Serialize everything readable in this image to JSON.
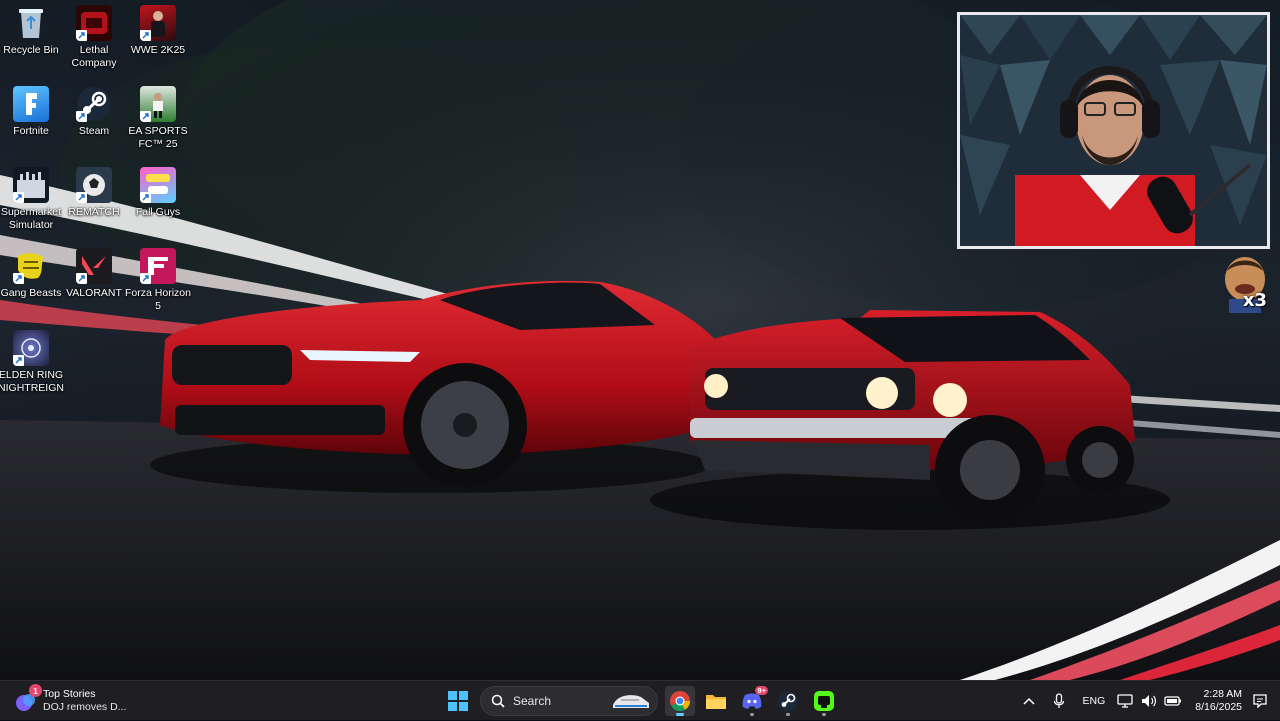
{
  "desktop": {
    "icons": [
      {
        "label": "Recycle Bin",
        "icon": "recycle-bin-icon"
      },
      {
        "label": "Lethal Company",
        "icon": "lethal-company-icon"
      },
      {
        "label": "WWE 2K25",
        "icon": "wwe-2k25-icon"
      },
      {
        "label": "Fortnite",
        "icon": "fortnite-icon"
      },
      {
        "label": "Steam",
        "icon": "steam-icon"
      },
      {
        "label": "EA SPORTS FC™ 25",
        "icon": "ea-sports-fc-icon"
      },
      {
        "label": "Supermarket Simulator",
        "icon": "supermarket-simulator-icon"
      },
      {
        "label": "REMATCH",
        "icon": "rematch-icon"
      },
      {
        "label": "Fall Guys",
        "icon": "fall-guys-icon"
      },
      {
        "label": "Gang Beasts",
        "icon": "gang-beasts-icon"
      },
      {
        "label": "VALORANT",
        "icon": "valorant-icon"
      },
      {
        "label": "Forza Horizon 5",
        "icon": "forza-horizon-icon"
      },
      {
        "label": "ELDEN RING NIGHTREIGN",
        "icon": "elden-ring-icon"
      }
    ]
  },
  "overlay": {
    "sticker_count": "x3"
  },
  "taskbar": {
    "news": {
      "title": "Top Stories",
      "headline": "DOJ removes D...",
      "badge": "1"
    },
    "search": {
      "label": "Search"
    },
    "apps": [
      "chrome-icon",
      "file-explorer-icon",
      "discord-icon",
      "steam-icon",
      "streaming-app-icon"
    ],
    "discord_badge": "9+",
    "tray": {
      "language": "ENG",
      "time": "2:28 AM",
      "date": "8/16/2025"
    }
  },
  "colors": {
    "accent": "#60cdff",
    "taskbar": "#1f1f23",
    "car_red": "#c4111c"
  }
}
